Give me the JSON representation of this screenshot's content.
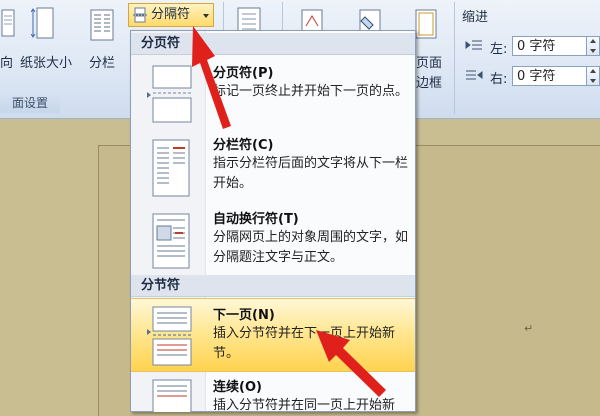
{
  "ribbon": {
    "orientation_label": "向",
    "page_size_label": "纸张大小",
    "columns_label": "分栏",
    "breaks_label": "分隔符",
    "page_setup_group": "面设置",
    "page_border_label_1": "页面",
    "page_border_label_2": "边框",
    "indent_group": "缩进",
    "indent_left_label": "左:",
    "indent_left_value": "0 字符",
    "indent_right_label": "右:",
    "indent_right_value": "0 字符"
  },
  "dropdown": {
    "page_breaks_header": "分页符",
    "section_breaks_header": "分节符",
    "items": [
      {
        "title": "分页符(P)",
        "desc": "标记一页终止并开始下一页的点。"
      },
      {
        "title": "分栏符(C)",
        "desc": "指示分栏符后面的文字将从下一栏开始。"
      },
      {
        "title": "自动换行符(T)",
        "desc": "分隔网页上的对象周围的文字，如分隔题注文字与正文。"
      },
      {
        "title": "下一页(N)",
        "desc": "插入分节符并在下一页上开始新节。"
      },
      {
        "title": "连续(O)",
        "desc": "插入分节符并在同一页上开始新节。"
      }
    ]
  },
  "document": {
    "paragraph_mark": "↵"
  },
  "colors": {
    "highlight": "#ffd34f",
    "annotation_arrow": "#e0201b",
    "document_bg": "#c6ba8d"
  }
}
